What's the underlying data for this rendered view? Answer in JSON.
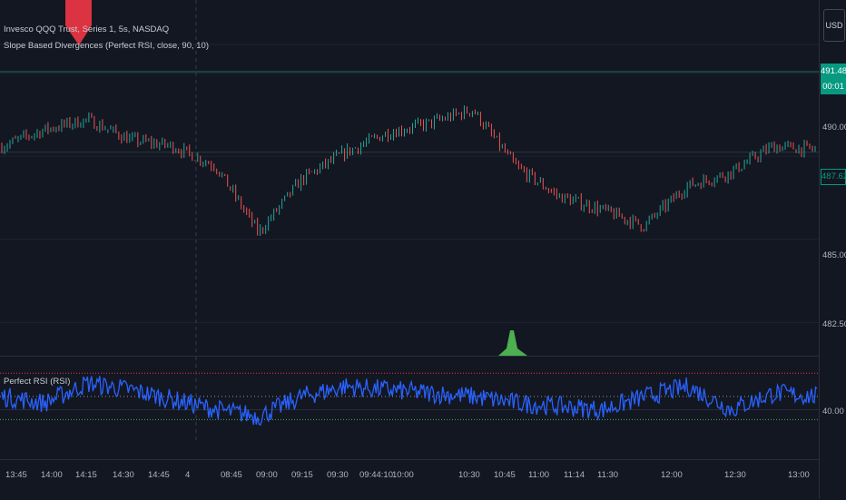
{
  "legend": {
    "series": "Invesco QQQ Trust, Series 1, 5s, NASDAQ",
    "indicator": "Slope Based Divergences (Perfect RSI, close, 90, 10)",
    "osc": "Perfect RSI (RSI)"
  },
  "price_axis": {
    "currency": "USD",
    "ticks": [
      "490.00",
      "487.50",
      "485.00",
      "482.50"
    ],
    "tag_top_price": "491.48",
    "tag_top_countdown": "00:01",
    "tag_mid_price": "487.62",
    "osc_tick": "40.00"
  },
  "time_axis": {
    "labels": [
      "13:45",
      "14:00",
      "14:15",
      "14:30",
      "14:45",
      "4",
      "08:45",
      "09:00",
      "09:15",
      "09:30",
      "09:44:10",
      "10:00",
      "10:30",
      "10:45",
      "11:00",
      "11:14",
      "11:30",
      "12:00",
      "12:30",
      "13:00"
    ]
  },
  "colors": {
    "background": "#131722",
    "rsi_line": "#2962ff",
    "up_candle": "#26a69a",
    "down_candle": "#ef5350",
    "bear_signal": "#f23645",
    "bull_signal": "#4caf50",
    "overbought_line": "#f23645",
    "oversold_line": "#4caf50"
  },
  "chart_data": {
    "type": "line",
    "price_series": {
      "x_labels": [
        "13:45",
        "14:00",
        "14:15",
        "14:30",
        "14:45",
        "4",
        "08:45",
        "09:00",
        "09:15",
        "09:30",
        "09:44:10",
        "10:00",
        "10:30",
        "10:45",
        "11:00",
        "11:14",
        "11:30",
        "12:00",
        "12:30",
        "13:00"
      ],
      "values": [
        487.8,
        488.3,
        488.6,
        488.0,
        487.8,
        487.2,
        485.2,
        486.8,
        487.6,
        488.2,
        488.5,
        488.9,
        487.2,
        486.3,
        485.9,
        485.4,
        486.6,
        487.0,
        487.8,
        487.7
      ],
      "ylim": [
        481.5,
        492.2
      ]
    },
    "rsi_series": {
      "values": [
        44,
        42,
        48,
        46,
        43,
        40,
        38,
        44,
        47,
        46,
        45,
        44,
        42,
        41,
        40,
        44,
        47,
        40,
        45,
        44
      ],
      "ylim": [
        30,
        56
      ],
      "overbought": 51,
      "oversold": 37,
      "midline": 44
    },
    "signals": [
      {
        "type": "bearish",
        "x": "14:15"
      },
      {
        "type": "bullish",
        "x": "10:45"
      }
    ]
  }
}
